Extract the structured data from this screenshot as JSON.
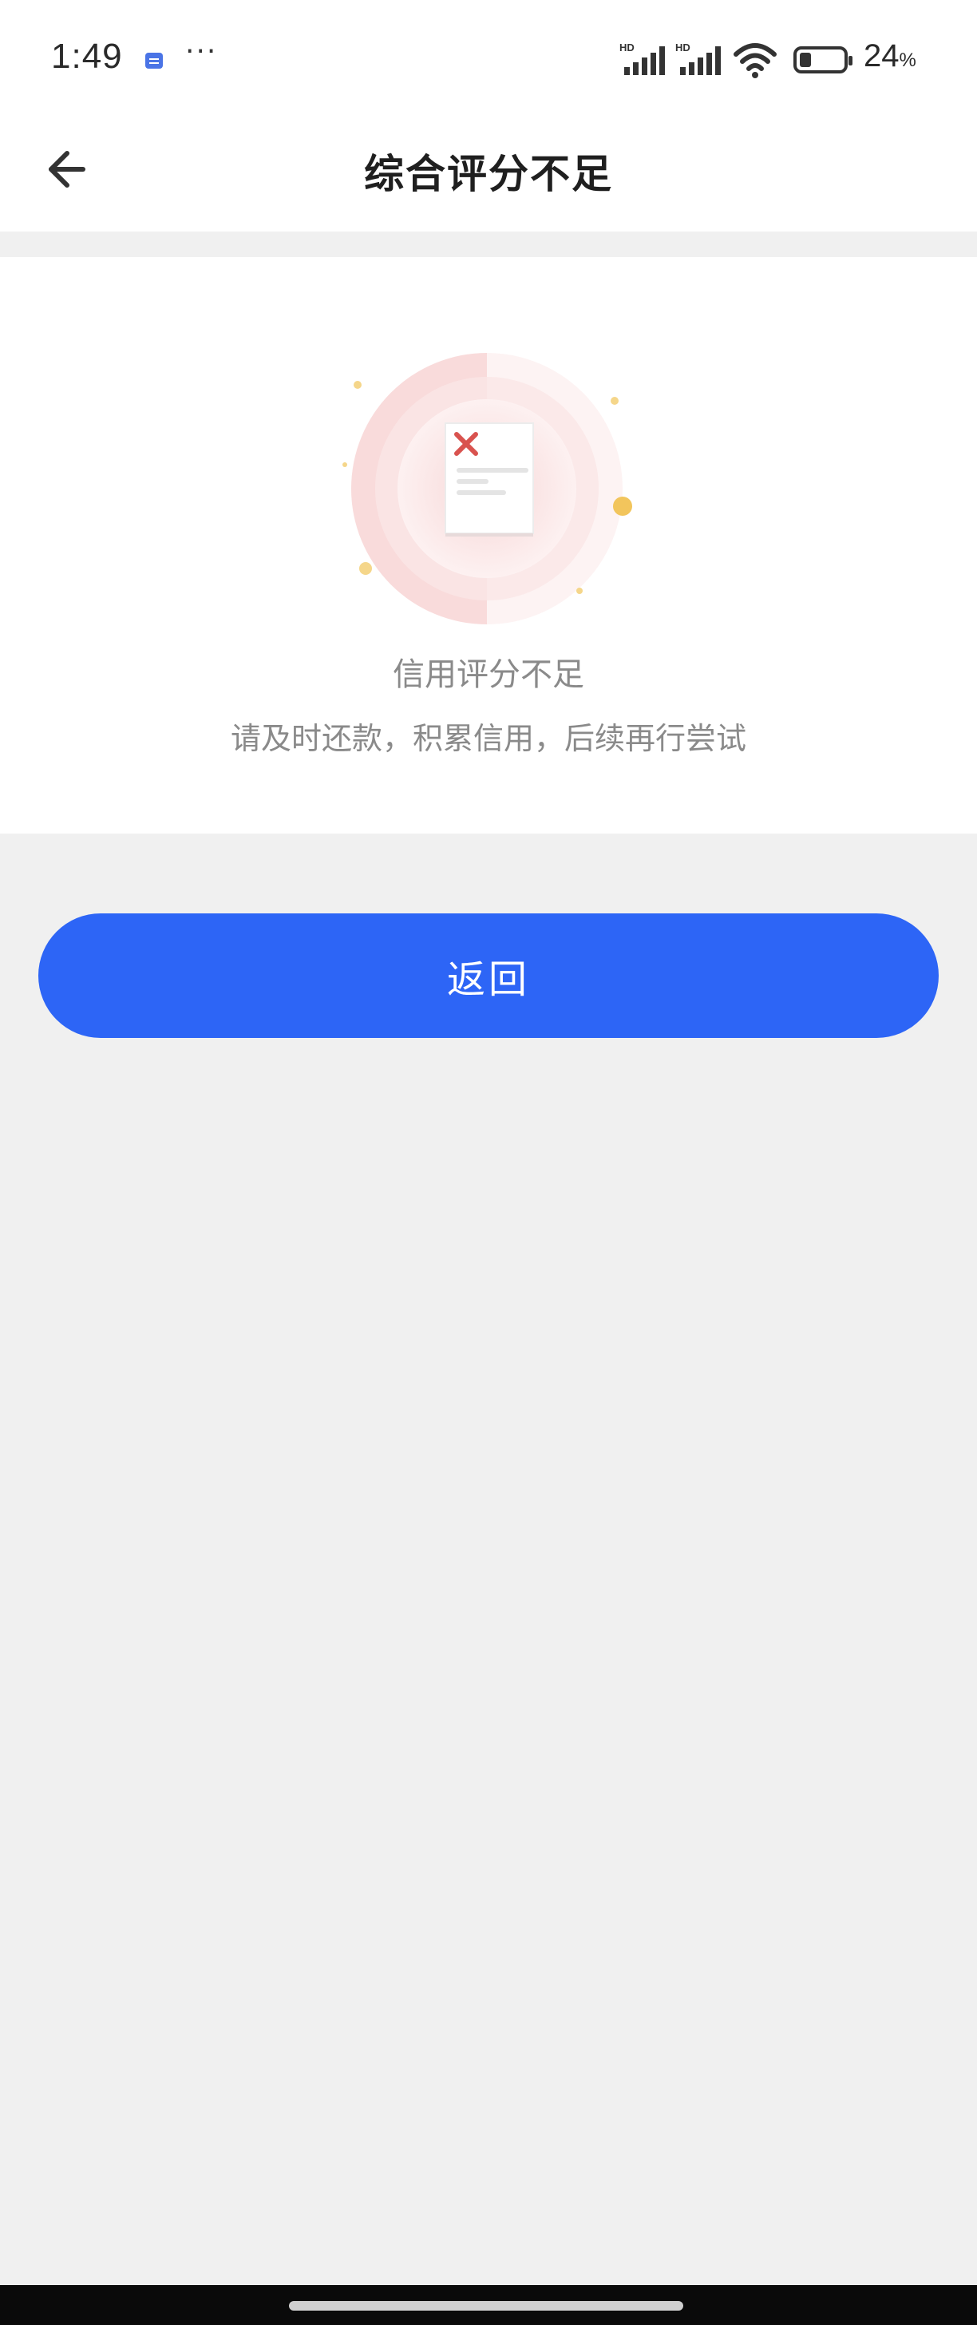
{
  "status_bar": {
    "time": "1:49",
    "battery_level": "24",
    "battery_unit": "%",
    "sim1_label": "HD",
    "sim2_label": "HD",
    "icons": [
      "message-icon",
      "more-icon",
      "signal-icon",
      "signal-icon",
      "wifi-icon",
      "battery-icon"
    ]
  },
  "header": {
    "title": "综合评分不足",
    "back_icon": "arrow-left-icon"
  },
  "result": {
    "illustration_icon": "rejected-document-icon",
    "title": "信用评分不足",
    "description": "请及时还款，积累信用，后续再行尝试"
  },
  "actions": {
    "return_label": "返回"
  },
  "colors": {
    "accent": "#2d65f6",
    "background": "#f0f0f0",
    "card": "#ffffff",
    "reject_red": "#d9534f"
  }
}
